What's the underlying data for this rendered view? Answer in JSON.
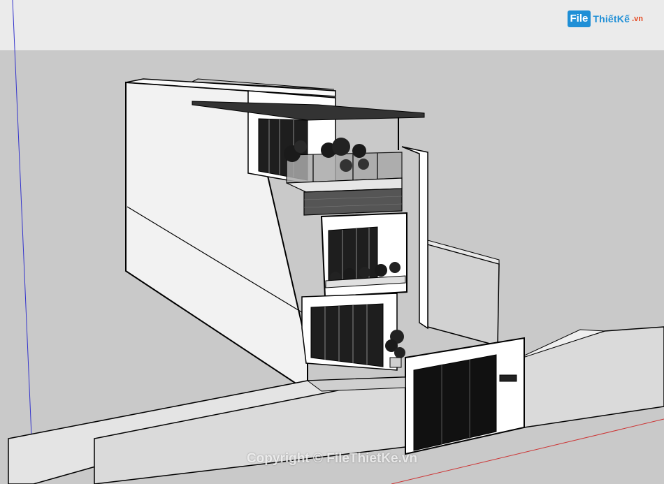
{
  "logo": {
    "badge": "File",
    "name": "ThiếtKế",
    "suffix": ".vn"
  },
  "watermark": "Copyright © FileThietKe.vn",
  "colors": {
    "sky": "#ebebeb",
    "ground": "#c9c9c9",
    "wall": "#f2f2f2",
    "side_wall": "#dcdcdc",
    "glass": "#1e1e1e",
    "brick": "#555555",
    "axis_blue": "#3333cc",
    "axis_red": "#cc3333",
    "logo_blue": "#1f8fd6",
    "logo_orange": "#e5481f"
  }
}
